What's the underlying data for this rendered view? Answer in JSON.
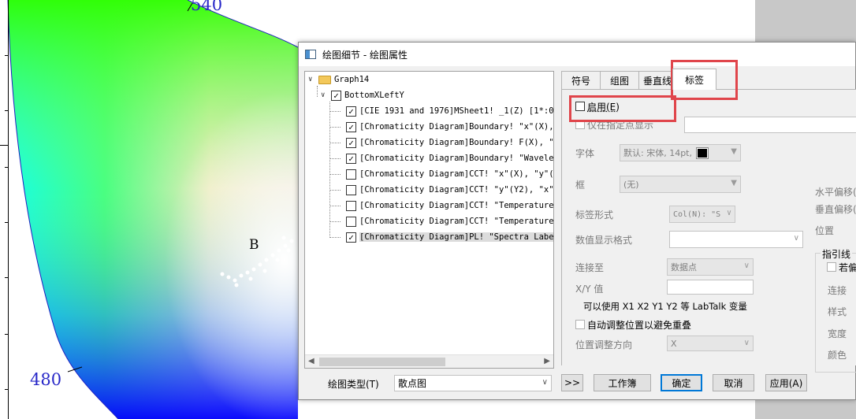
{
  "graph": {
    "wavelength_labels": [
      "540",
      "480"
    ],
    "point_label": "B"
  },
  "dialog": {
    "title": "绘图细节 - 绘图属性"
  },
  "tree": {
    "root": "Graph14",
    "layer": "BottomXLeftY",
    "items": [
      {
        "text": "[CIE 1931 and 1976]MSheet1! _1(Z) [1*:0",
        "checked": true
      },
      {
        "text": "[Chromaticity Diagram]Boundary! \"x\"(X), \"",
        "checked": true
      },
      {
        "text": "[Chromaticity Diagram]Boundary! F(X), \"",
        "checked": true
      },
      {
        "text": "[Chromaticity Diagram]Boundary! \"Wavele",
        "checked": true
      },
      {
        "text": "[Chromaticity Diagram]CCT! \"x\"(X), \"y\"(",
        "checked": false
      },
      {
        "text": "[Chromaticity Diagram]CCT! \"y\"(Y2), \"x\"",
        "checked": false
      },
      {
        "text": "[Chromaticity Diagram]CCT! \"Temperature",
        "checked": false
      },
      {
        "text": "[Chromaticity Diagram]CCT! \"Temperature",
        "checked": false
      },
      {
        "text": "[Chromaticity Diagram]PL! \"Spectra Labe",
        "checked": true
      }
    ]
  },
  "tabs": [
    "符号",
    "组图",
    "垂直线",
    "标签"
  ],
  "label_tab": {
    "enable": "启用(E)",
    "only_specified": "仅在指定点显示",
    "font_label": "字体",
    "font_value": "默认: 宋体, 14pt,",
    "frame_label": "框",
    "frame_value": "(无)",
    "label_form_label": "标签形式",
    "label_form_value": "Col(N): \"S",
    "numeric_format_label": "数值显示格式",
    "connect_to_label": "连接至",
    "connect_to_value": "数据点",
    "xy_value_label": "X/Y 值",
    "hint": "可以使用 X1 X2 Y1 Y2 等 LabTalk 变量",
    "auto_adjust": "自动调整位置以避免重叠",
    "direction_label": "位置调整方向",
    "direction_value": "X",
    "h_offset": "水平偏移(",
    "v_offset": "垂直偏移(",
    "position": "位置",
    "leader_group": "指引线",
    "leader_if": "若偏",
    "leader_connect": "连接",
    "leader_style": "样式",
    "leader_width": "宽度",
    "leader_color": "颜色"
  },
  "footer": {
    "plot_type_label": "绘图类型(T)",
    "plot_type_value": "散点图",
    "expand_button": ">>",
    "workbook_button": "工作簿",
    "ok_button": "确定",
    "cancel_button": "取消",
    "apply_button": "应用(A)"
  },
  "colors": {
    "annotation": "#e0454b",
    "wavelength_text": "#2828c8",
    "accent": "#0078d7"
  }
}
